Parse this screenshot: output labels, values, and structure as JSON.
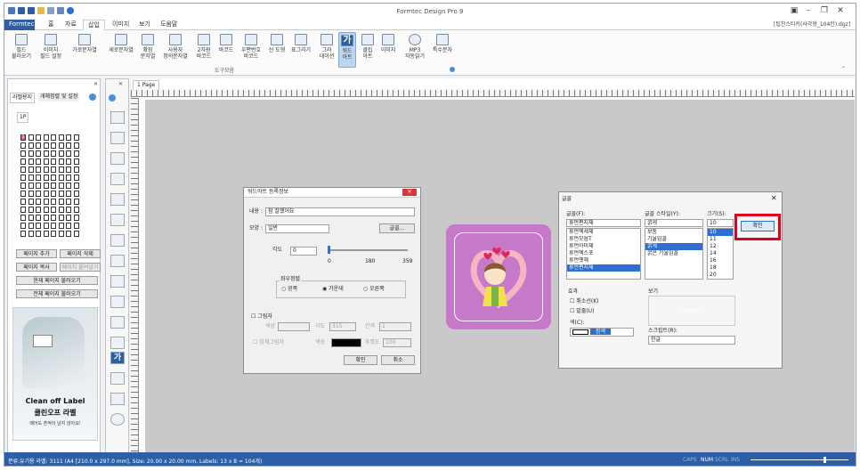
{
  "app": {
    "title": "Formtec Design Pro 9",
    "file_path": "[팁찬스티커(사각형_104칸).dgz]"
  },
  "tabs": [
    "Formtec",
    "홈",
    "자료",
    "삽입",
    "이미지",
    "보기",
    "도움말"
  ],
  "active_tab": "삽입",
  "ribbon": {
    "buttons": [
      {
        "label": "필드\n불러오기"
      },
      {
        "label": "이미지\n필드 설정"
      },
      {
        "label": "가로문자열"
      },
      {
        "label": "세로문자열"
      },
      {
        "label": "확장\n문자열"
      },
      {
        "label": "사용자\n정의문자열"
      },
      {
        "label": "2차원\n바코드"
      },
      {
        "label": "바코드"
      },
      {
        "label": "우편번호\n바코드"
      },
      {
        "label": "선 도형"
      },
      {
        "label": "표그리기"
      },
      {
        "label": "그라\n데이션"
      },
      {
        "label": "워드\n아트"
      },
      {
        "label": "클립\n아트"
      },
      {
        "label": "이미지"
      },
      {
        "label": "MP3\n자동읽기"
      },
      {
        "label": "특수문자"
      }
    ],
    "group_label": "도구모음"
  },
  "left_panel": {
    "tabs": [
      "라벨용지",
      "개체정렬 및 설정"
    ],
    "page_tab": "1P",
    "selected_cell": "1",
    "buttons": [
      "페이지 추가",
      "페이지 삭제",
      "페이지 복사",
      "페이지 붙여넣기",
      "현재 페이지 불러오기",
      "전체 페이지 불러오기"
    ],
    "ad": {
      "brand": "Clean off Label",
      "title": "클린오프 라벨",
      "subtitle": "떼어도 흔적이 남지 않아요!"
    }
  },
  "doc": {
    "page_tab": "1 Page"
  },
  "wordart_dialog": {
    "title": "워드아트 등록정보",
    "content_label": "내용 :",
    "content_value": "참 잘했어요",
    "shape_label": "모양 :",
    "shape_value": "일반",
    "font_button": "글꼴...",
    "angle_label": "각도",
    "angle_value": "0",
    "slider_ticks": [
      "0",
      "180",
      "359"
    ],
    "align_group": "좌우정렬",
    "align_options": [
      "왼쪽",
      "가운데",
      "오른쪽"
    ],
    "align_selected": "가운데",
    "shadow_label": "그림자",
    "shadow_color_label": "색상",
    "shadow_angle_label": "각도",
    "shadow_angle_value": "315",
    "shadow_gap_label": "간격",
    "shadow_gap_value": "1",
    "shadow3d_label": "입체그림자",
    "shadow3d_color_label": "색상",
    "opacity_label": "투명도",
    "opacity_value": "100",
    "ok": "확인",
    "cancel": "취소"
  },
  "font_dialog": {
    "title": "글꼴",
    "font_label": "글꼴(F):",
    "font_value": "휴먼편지체",
    "fonts": [
      "휴먼엑세체",
      "휴먼모음T",
      "휴먼아미체",
      "휴먼엑스포",
      "휴먼옛체",
      "휴먼편지체"
    ],
    "style_label": "글꼴 스타일(Y):",
    "style_value": "굵게",
    "styles": [
      "보통",
      "기울임꼴",
      "굵게",
      "굵은 기울임꼴"
    ],
    "size_label": "크기(S):",
    "size_value": "10",
    "sizes": [
      "10",
      "11",
      "12",
      "14",
      "16",
      "18",
      "20"
    ],
    "ok": "확인",
    "effects_label": "효과",
    "strike_label": "취소선(K)",
    "underline_label": "밑줄(U)",
    "color_label": "색(C):",
    "color_value": "흰색",
    "sample_label": "보기",
    "sample_text": "AaBbYyZz",
    "script_label": "스크립트(R):",
    "script_value": "한글"
  },
  "status": {
    "left": "분류:유기용 라벨: 3111 (A4 [210.0 x 297.0 mm], Size: 20.00 x 20.00 mm, Labels: 13 x 8 = 104개)",
    "indicators": [
      "CAPS",
      "NUM",
      "SCRL",
      "INS"
    ]
  },
  "colors": {
    "accent": "#2c5fa6",
    "highlight": "#e0001b",
    "label_bg": "#c678c9"
  }
}
